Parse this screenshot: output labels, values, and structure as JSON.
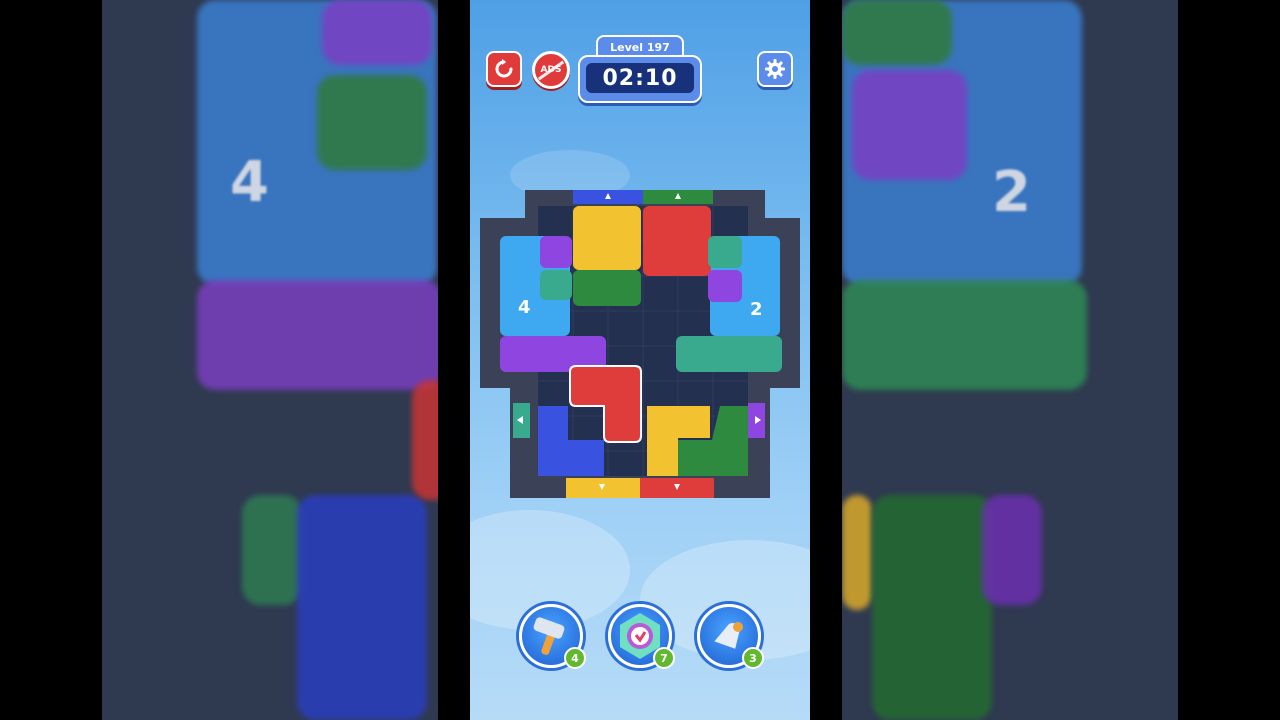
{
  "level": {
    "label": "Level 197"
  },
  "timer": {
    "value": "02:10"
  },
  "buttons": {
    "ads_label": "ADS"
  },
  "board": {
    "left_counter": "4",
    "right_counter": "2",
    "colors": {
      "yellow": "#f2c230",
      "red": "#df3c3c",
      "green": "#2e8a3e",
      "teal": "#3aaa8e",
      "purple": "#8f46e0",
      "blue": "#3a52e0",
      "frame": "#3b4157",
      "cell": "#23304f",
      "water": "#3ea8f0"
    }
  },
  "tools": [
    {
      "name": "hammer",
      "count": "4"
    },
    {
      "name": "clock",
      "count": "7"
    },
    {
      "name": "bell",
      "count": "3"
    }
  ],
  "backdrop": {
    "left_number": "4",
    "right_number": "2"
  }
}
